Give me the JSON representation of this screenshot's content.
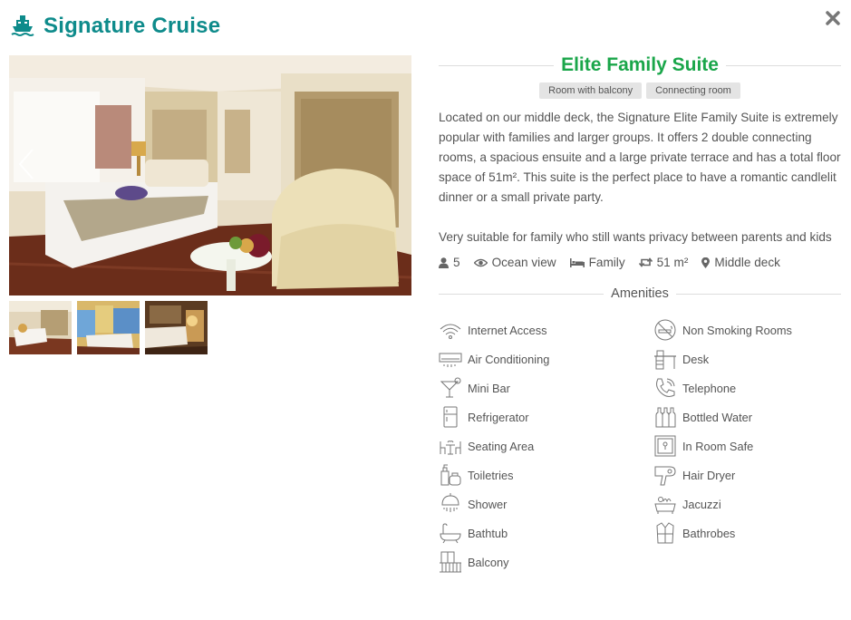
{
  "header": {
    "title": "Signature Cruise",
    "icon": "cruise-ship-icon"
  },
  "room": {
    "title": "Elite Family Suite",
    "tags": [
      "Room with balcony",
      "Connecting room"
    ],
    "description": [
      "Located on our middle deck, the Signature Elite Family Suite is extremely popular with families and larger groups. It offers 2 double connecting rooms, a spacious ensuite and a large private terrace and has a total floor space of 51m². This suite is the perfect place to have a romantic candlelit dinner or a small private party.",
      "Very suitable for family who still wants privacy between parents and kids"
    ],
    "specs": {
      "guests": "5",
      "view": "Ocean view",
      "bed": "Family",
      "size": "51 m²",
      "deck": "Middle deck"
    }
  },
  "amenities": {
    "title": "Amenities",
    "items": [
      {
        "label": "Internet Access",
        "icon": "wifi-icon"
      },
      {
        "label": "Non Smoking Rooms",
        "icon": "no-smoking-icon"
      },
      {
        "label": "Air Conditioning",
        "icon": "air-conditioner-icon"
      },
      {
        "label": "Desk",
        "icon": "desk-icon"
      },
      {
        "label": "Mini Bar",
        "icon": "cocktail-icon"
      },
      {
        "label": "Telephone",
        "icon": "telephone-icon"
      },
      {
        "label": "Refrigerator",
        "icon": "refrigerator-icon"
      },
      {
        "label": "Bottled Water",
        "icon": "bottles-icon"
      },
      {
        "label": "Seating Area",
        "icon": "seating-area-icon"
      },
      {
        "label": "In Room Safe",
        "icon": "safe-icon"
      },
      {
        "label": "Toiletries",
        "icon": "toiletries-icon"
      },
      {
        "label": "Hair Dryer",
        "icon": "hair-dryer-icon"
      },
      {
        "label": "Shower",
        "icon": "shower-icon"
      },
      {
        "label": "Jacuzzi",
        "icon": "jacuzzi-icon"
      },
      {
        "label": "Bathtub",
        "icon": "bathtub-icon"
      },
      {
        "label": "Bathrobes",
        "icon": "bathrobe-icon"
      },
      {
        "label": "Balcony",
        "icon": "balcony-icon"
      }
    ]
  },
  "colors": {
    "title": "#0e8b8b",
    "room_title": "#1aa64a",
    "tag_bg": "#e4e4e4"
  }
}
